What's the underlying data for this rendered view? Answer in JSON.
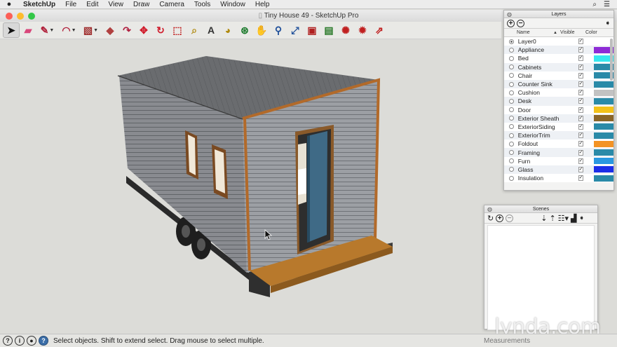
{
  "menubar": {
    "apple_icon": "apple-logo",
    "app_name": "SketchUp",
    "items": [
      "File",
      "Edit",
      "View",
      "Draw",
      "Camera",
      "Tools",
      "Window",
      "Help"
    ]
  },
  "window": {
    "title": "Tiny House 49 - SketchUp Pro",
    "buttons": {
      "close": "#fc5f57",
      "minimize": "#fdbc2e",
      "zoom": "#33c748"
    }
  },
  "toolbar": {
    "tools": [
      {
        "name": "select-tool-icon",
        "glyph": "➤",
        "color": "#111111",
        "selected": true
      },
      {
        "name": "eraser-tool-icon",
        "glyph": "▰",
        "color": "#d8467a"
      },
      {
        "name": "line-tool-icon",
        "glyph": "✎",
        "color": "#b0203a",
        "dropdown": true
      },
      {
        "name": "arc-tool-icon",
        "glyph": "◠",
        "color": "#b0203a",
        "dropdown": true
      },
      {
        "name": "rectangle-tool-icon",
        "glyph": "▧",
        "color": "#a03030",
        "dropdown": true
      },
      {
        "name": "push-pull-tool-icon",
        "glyph": "◆",
        "color": "#b04040"
      },
      {
        "name": "follow-me-tool-icon",
        "glyph": "↷",
        "color": "#b02040"
      },
      {
        "name": "move-tool-icon",
        "glyph": "✥",
        "color": "#d01c2c"
      },
      {
        "name": "rotate-tool-icon",
        "glyph": "↻",
        "color": "#d01c2c"
      },
      {
        "name": "scale-tool-icon",
        "glyph": "⬚",
        "color": "#c02020"
      },
      {
        "name": "tape-measure-tool-icon",
        "glyph": "⌕",
        "color": "#b08a10"
      },
      {
        "name": "text-tool-icon",
        "glyph": "A",
        "color": "#333333"
      },
      {
        "name": "paint-bucket-tool-icon",
        "glyph": "◕",
        "color": "#b08a10"
      },
      {
        "name": "orbit-tool-icon",
        "glyph": "⊛",
        "color": "#1c7a2c"
      },
      {
        "name": "pan-tool-icon",
        "glyph": "✋",
        "color": "#555555"
      },
      {
        "name": "zoom-tool-icon",
        "glyph": "⚲",
        "color": "#1f4f9a"
      },
      {
        "name": "zoom-extents-tool-icon",
        "glyph": "⤢",
        "color": "#1f4f9a"
      },
      {
        "name": "3d-warehouse-icon",
        "glyph": "▣",
        "color": "#b02020"
      },
      {
        "name": "extension-warehouse-icon",
        "glyph": "▤",
        "color": "#2a7a2a"
      },
      {
        "name": "share-model-icon",
        "glyph": "✺",
        "color": "#c02020"
      },
      {
        "name": "extension-manager-icon",
        "glyph": "✹",
        "color": "#c02020"
      },
      {
        "name": "send-to-layout-icon",
        "glyph": "⇗",
        "color": "#c02020"
      }
    ]
  },
  "status": {
    "text": "Select objects. Shift to extend select. Drag mouse to select multiple.",
    "measurements_label": "Measurements"
  },
  "layers_panel": {
    "title": "Layers",
    "col_name": "Name",
    "col_visible": "Visible",
    "col_color": "Color",
    "layers": [
      {
        "name": "Layer0",
        "visible": true,
        "color": null,
        "active": true
      },
      {
        "name": "Appliance",
        "visible": true,
        "color": "#8e2bd6"
      },
      {
        "name": "Bed",
        "visible": true,
        "color": "#37e8ef"
      },
      {
        "name": "Cabinets",
        "visible": true,
        "color": "#2a8aa8"
      },
      {
        "name": "Chair",
        "visible": true,
        "color": "#2a8aa8"
      },
      {
        "name": "Counter Sink",
        "visible": true,
        "color": "#2a8aa8"
      },
      {
        "name": "Cushion",
        "visible": true,
        "color": "#c2c2c2"
      },
      {
        "name": "Desk",
        "visible": true,
        "color": "#2a8aa8"
      },
      {
        "name": "Door",
        "visible": true,
        "color": "#f2c21a"
      },
      {
        "name": "Exterior Sheath",
        "visible": true,
        "color": "#8a6628"
      },
      {
        "name": "ExteriorSiding",
        "visible": true,
        "color": "#2a8aa8"
      },
      {
        "name": "ExteriorTrim",
        "visible": true,
        "color": "#2a8aa8"
      },
      {
        "name": "Foldout",
        "visible": true,
        "color": "#f39324"
      },
      {
        "name": "Framing",
        "visible": true,
        "color": "#2a8aa8"
      },
      {
        "name": "Furn",
        "visible": true,
        "color": "#2a98e0"
      },
      {
        "name": "Glass",
        "visible": true,
        "color": "#1c2ee8"
      },
      {
        "name": "Insulation",
        "visible": true,
        "color": "#2a8aa8"
      }
    ]
  },
  "scenes_panel": {
    "title": "Scenes"
  },
  "watermark": "lynda.com"
}
